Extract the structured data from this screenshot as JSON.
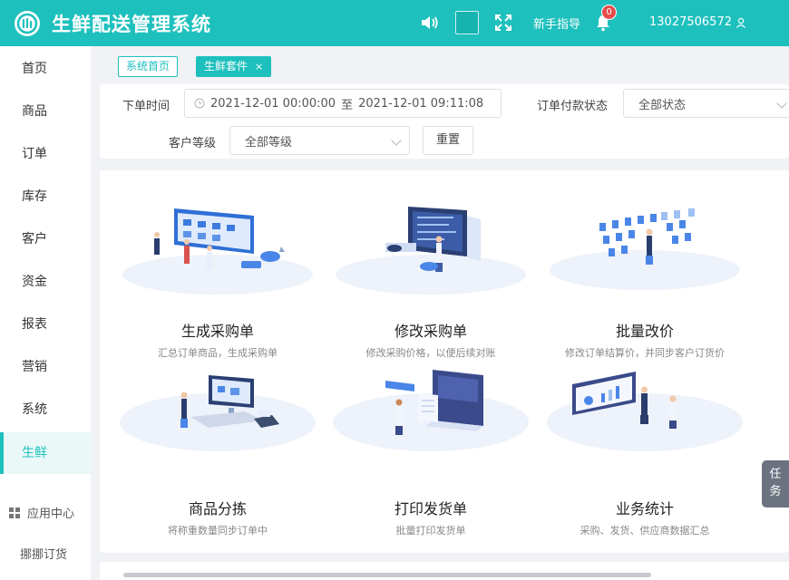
{
  "header": {
    "app_title": "生鲜配送管理系统",
    "guide": "新手指导",
    "notification_count": "0",
    "user_phone": "13027506572",
    "brand_color": "#1ec0bd"
  },
  "sidebar": {
    "items": [
      {
        "label": "首页"
      },
      {
        "label": "商品"
      },
      {
        "label": "订单"
      },
      {
        "label": "库存"
      },
      {
        "label": "客户"
      },
      {
        "label": "资金"
      },
      {
        "label": "报表"
      },
      {
        "label": "营销"
      },
      {
        "label": "系统"
      },
      {
        "label": "生鲜",
        "active": true
      }
    ],
    "app_center": "应用中心",
    "bottom_link": "挪挪订货"
  },
  "tabs": [
    {
      "label": "系统首页"
    },
    {
      "label": "生鲜套件",
      "close": "×"
    }
  ],
  "filter": {
    "order_time_label": "下单时间",
    "date_start": "2021-12-01 00:00:00",
    "date_sep": "至",
    "date_end": "2021-12-01 09:11:08",
    "pay_status_label": "订单付款状态",
    "pay_status_value": "全部状态",
    "customer_level_label": "客户等级",
    "customer_level_value": "全部等级",
    "reset": "重置"
  },
  "cards": [
    {
      "title": "生成采购单",
      "desc": "汇总订单商品，生成采购单"
    },
    {
      "title": "修改采购单",
      "desc": "修改采购价格，以便后续对账"
    },
    {
      "title": "批量改价",
      "desc": "修改订单结算价，并同步客户订货价"
    },
    {
      "title": "商品分拣",
      "desc": "将称重数量同步订单中"
    },
    {
      "title": "打印发货单",
      "desc": "批量打印发货单"
    },
    {
      "title": "业务统计",
      "desc": "采购、发货、供应商数据汇总"
    }
  ],
  "task_float": {
    "line1": "任",
    "line2": "务"
  }
}
